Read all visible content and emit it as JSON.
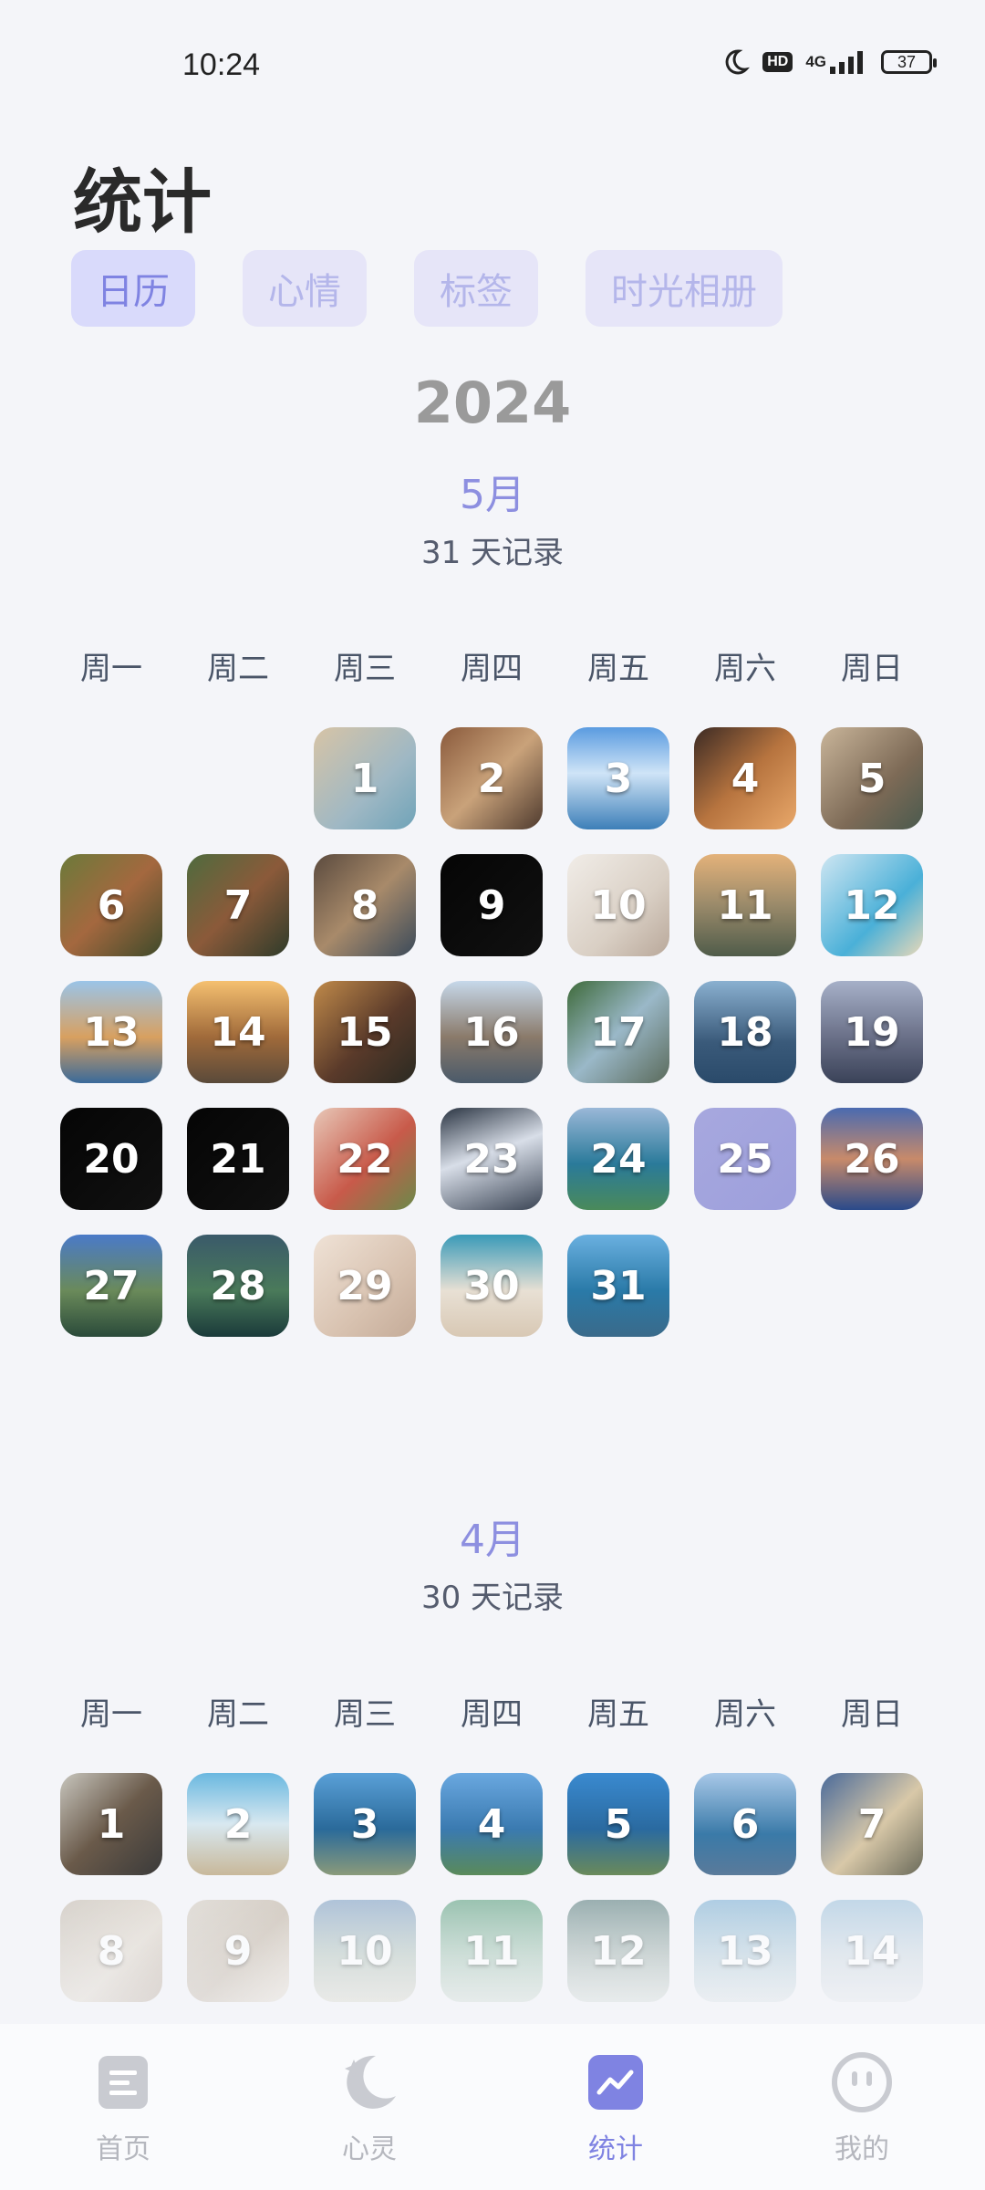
{
  "status": {
    "time": "10:24",
    "hd": "HD",
    "network": "4G",
    "battery": "37"
  },
  "header": {
    "title": "统计"
  },
  "tabs": [
    {
      "label": "日历",
      "active": true
    },
    {
      "label": "心情",
      "active": false
    },
    {
      "label": "标签",
      "active": false
    },
    {
      "label": "时光相册",
      "active": false
    }
  ],
  "year": "2024",
  "weekdays": [
    "周一",
    "周二",
    "周三",
    "周四",
    "周五",
    "周六",
    "周日"
  ],
  "months": [
    {
      "title": "5月",
      "subtitle": "31 天记录",
      "days": [
        "1",
        "2",
        "3",
        "4",
        "5",
        "6",
        "7",
        "8",
        "9",
        "10",
        "11",
        "12",
        "13",
        "14",
        "15",
        "16",
        "17",
        "18",
        "19",
        "20",
        "21",
        "22",
        "23",
        "24",
        "25",
        "26",
        "27",
        "28",
        "29",
        "30",
        "31"
      ]
    },
    {
      "title": "4月",
      "subtitle": "30 天记录",
      "days": [
        "1",
        "2",
        "3",
        "4",
        "5",
        "6",
        "7",
        "8",
        "9",
        "10",
        "11",
        "12",
        "13",
        "14"
      ]
    }
  ],
  "nav": [
    {
      "label": "首页",
      "icon": "document-icon",
      "active": false
    },
    {
      "label": "心灵",
      "icon": "moon-star-icon",
      "active": false
    },
    {
      "label": "统计",
      "icon": "chart-icon",
      "active": true
    },
    {
      "label": "我的",
      "icon": "face-icon",
      "active": false
    }
  ],
  "colors": {
    "accent": "#8d8fe0",
    "tab_bg": "#e6e5f8",
    "background": "#f4f5f9"
  }
}
